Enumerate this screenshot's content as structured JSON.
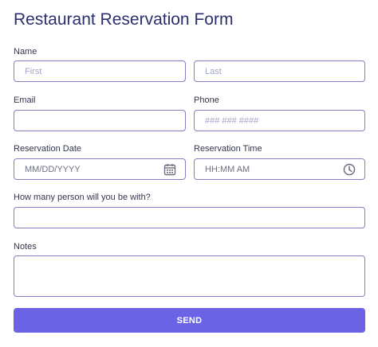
{
  "form": {
    "title": "Restaurant Reservation Form",
    "name": {
      "label": "Name",
      "first_placeholder": "First",
      "last_placeholder": "Last"
    },
    "email": {
      "label": "Email",
      "value": ""
    },
    "phone": {
      "label": "Phone",
      "placeholder": "### ### ####"
    },
    "reservation_date": {
      "label": "Reservation Date",
      "placeholder": "MM/DD/YYYY",
      "icon": "calendar-icon"
    },
    "reservation_time": {
      "label": "Reservation Time",
      "placeholder": "HH:MM AM",
      "icon": "clock-icon"
    },
    "party_size": {
      "label": "How many person will you be with?",
      "value": ""
    },
    "notes": {
      "label": "Notes",
      "value": ""
    },
    "send_label": "SEND"
  },
  "colors": {
    "title": "#2b2f6e",
    "border": "#8180c5",
    "button": "#6b63e6",
    "button_text": "#ffffff",
    "placeholder": "#a2a6c8"
  }
}
